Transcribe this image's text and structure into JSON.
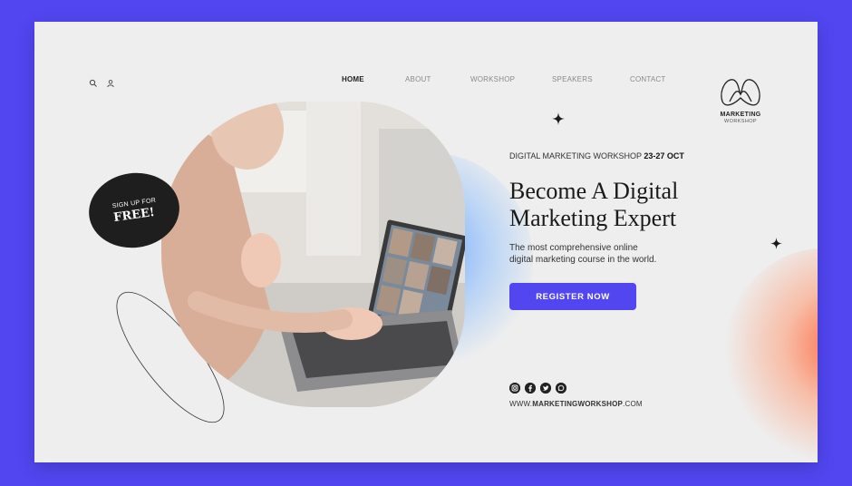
{
  "nav": {
    "items": [
      {
        "label": "HOME",
        "active": true
      },
      {
        "label": "ABOUT",
        "active": false
      },
      {
        "label": "WORKSHOP",
        "active": false
      },
      {
        "label": "SPEAKERS",
        "active": false
      },
      {
        "label": "CONTACT",
        "active": false
      }
    ],
    "icons": [
      "search-icon",
      "user-icon"
    ]
  },
  "logo": {
    "title": "MARKETING",
    "subtitle": "WORKSHOP"
  },
  "badge": {
    "line1": "SIGN UP FOR",
    "line2": "FREE!"
  },
  "hero": {
    "eyebrow_prefix": "DIGITAL MARKETING WORKSHOP ",
    "eyebrow_dates": "23-27 OCT",
    "headline_line1": "Become A Digital",
    "headline_line2": "Marketing Expert",
    "description_line1": "The most comprehensive online",
    "description_line2": "digital marketing course in the world.",
    "cta_label": "REGISTER NOW"
  },
  "social": {
    "icons": [
      "instagram-icon",
      "facebook-icon",
      "twitter-icon",
      "whatsapp-icon"
    ]
  },
  "website": {
    "prefix": "WWW.",
    "domain": "MARKETINGWORKSHOP",
    "suffix": ".COM"
  },
  "colors": {
    "accent": "#5146f0",
    "background": "#eeeeee",
    "badge": "#1e1e1e"
  }
}
